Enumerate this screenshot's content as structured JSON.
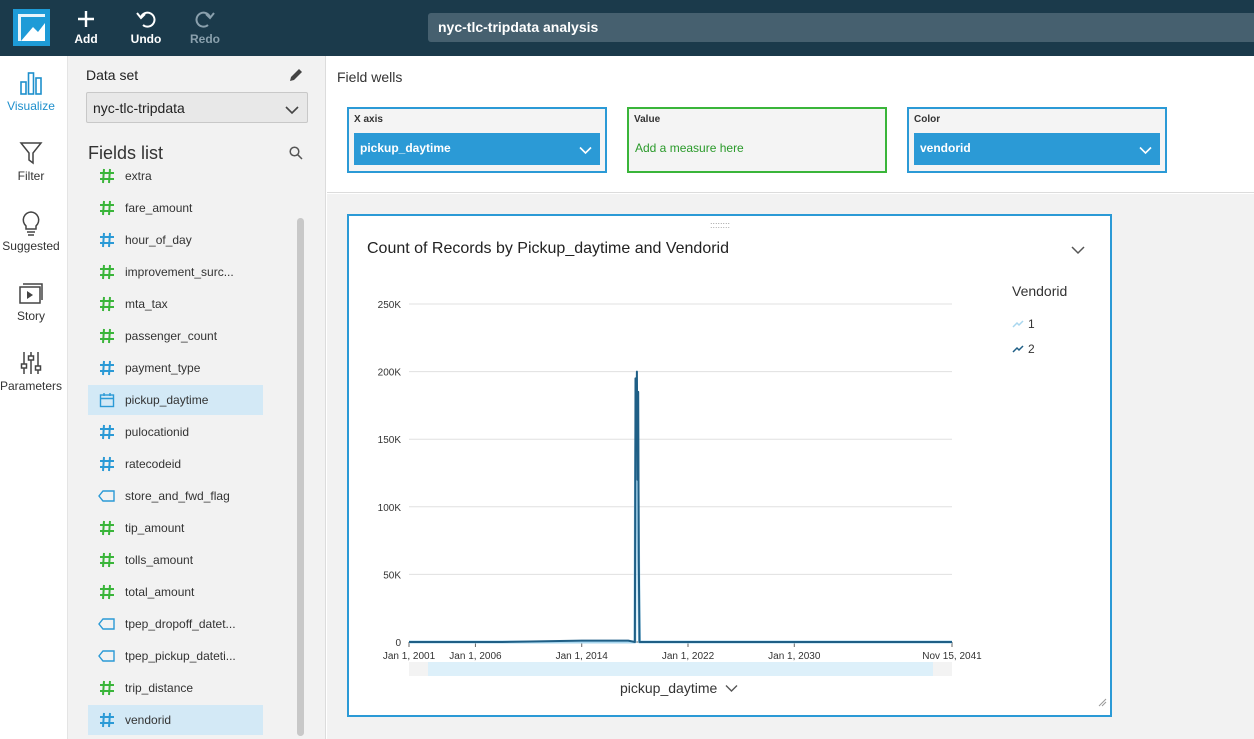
{
  "toolbar": {
    "add_label": "Add",
    "undo_label": "Undo",
    "redo_label": "Redo",
    "analysis_title": "nyc-tlc-tripdata analysis",
    "icons": [
      "plus-icon",
      "undo-icon",
      "redo-icon"
    ]
  },
  "rail": {
    "items": [
      {
        "label": "Visualize",
        "icon": "bar-chart-icon",
        "active": true
      },
      {
        "label": "Filter",
        "icon": "funnel-icon",
        "active": false
      },
      {
        "label": "Suggested",
        "icon": "lightbulb-icon",
        "active": false
      },
      {
        "label": "Story",
        "icon": "story-icon",
        "active": false
      },
      {
        "label": "Parameters",
        "icon": "sliders-icon",
        "active": false
      }
    ]
  },
  "dataset": {
    "label": "Data set",
    "selected": "nyc-tlc-tripdata"
  },
  "fields_list": {
    "title": "Fields list",
    "fields": [
      {
        "name": "extra",
        "type": "measure"
      },
      {
        "name": "fare_amount",
        "type": "measure"
      },
      {
        "name": "hour_of_day",
        "type": "dimension-number"
      },
      {
        "name": "improvement_surc...",
        "type": "measure"
      },
      {
        "name": "mta_tax",
        "type": "measure"
      },
      {
        "name": "passenger_count",
        "type": "measure"
      },
      {
        "name": "payment_type",
        "type": "dimension-number"
      },
      {
        "name": "pickup_daytime",
        "type": "date",
        "selected": true
      },
      {
        "name": "pulocationid",
        "type": "dimension-number"
      },
      {
        "name": "ratecodeid",
        "type": "dimension-number"
      },
      {
        "name": "store_and_fwd_flag",
        "type": "string"
      },
      {
        "name": "tip_amount",
        "type": "measure"
      },
      {
        "name": "tolls_amount",
        "type": "measure"
      },
      {
        "name": "total_amount",
        "type": "measure"
      },
      {
        "name": "tpep_dropoff_datet...",
        "type": "string"
      },
      {
        "name": "tpep_pickup_dateti...",
        "type": "string"
      },
      {
        "name": "trip_distance",
        "type": "measure"
      },
      {
        "name": "vendorid",
        "type": "dimension-number",
        "selected": true
      }
    ]
  },
  "field_wells": {
    "title": "Field wells",
    "x_axis": {
      "label": "X axis",
      "value": "pickup_daytime"
    },
    "value": {
      "label": "Value",
      "placeholder": "Add a measure here"
    },
    "color": {
      "label": "Color",
      "value": "vendorid"
    }
  },
  "visual": {
    "title": "Count of Records by Pickup_daytime and Vendorid",
    "x_field_label": "pickup_daytime",
    "legend_title": "Vendorid"
  },
  "colors": {
    "accent": "#2b9ad6",
    "measure_green": "#3ab53a",
    "topbar": "#1b3a4b",
    "series_1": "#a9d7ef",
    "series_2": "#1f5f86"
  },
  "chart_data": {
    "type": "line",
    "title": "Count of Records by Pickup_daytime and Vendorid",
    "xlabel": "pickup_daytime",
    "ylabel": "",
    "ylim": [
      0,
      250000
    ],
    "y_ticks": [
      "0",
      "50K",
      "100K",
      "150K",
      "200K",
      "250K"
    ],
    "y_tick_values": [
      0,
      50000,
      100000,
      150000,
      200000,
      250000
    ],
    "x_ticks": [
      "Jan 1, 2001",
      "Jan 1, 2006",
      "Jan 1, 2014",
      "Jan 1, 2022",
      "Jan 1, 2030",
      "Nov 15, 2041"
    ],
    "x_tick_values": [
      2001.0,
      2006.0,
      2014.0,
      2022.0,
      2030.0,
      2041.87
    ],
    "xlim": [
      2001.0,
      2041.87
    ],
    "legend_position": "right",
    "grid": true,
    "series": [
      {
        "name": "1",
        "x": [
          2001.0,
          2008.0,
          2014.0,
          2017.5,
          2018.0,
          2018.05,
          2018.1,
          2018.15,
          2018.2,
          2018.3,
          2018.35,
          2019.0,
          2041.87
        ],
        "values": [
          0,
          0,
          0,
          0,
          0,
          120000,
          170000,
          90000,
          160000,
          40000,
          0,
          0,
          0
        ]
      },
      {
        "name": "2",
        "x": [
          2001.0,
          2008.0,
          2014.0,
          2017.5,
          2018.0,
          2018.05,
          2018.1,
          2018.15,
          2018.2,
          2018.25,
          2018.3,
          2018.35,
          2019.0,
          2041.87
        ],
        "values": [
          0,
          0,
          1000,
          1000,
          0,
          195000,
          150000,
          200000,
          120000,
          185000,
          60000,
          0,
          0,
          0
        ]
      }
    ]
  }
}
